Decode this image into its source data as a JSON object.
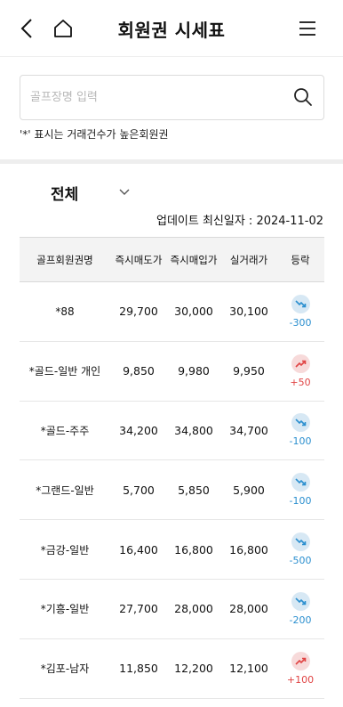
{
  "header": {
    "title": "회원권 시세표"
  },
  "search": {
    "placeholder": "골프장명 입력",
    "value": ""
  },
  "note": "'*' 표시는 거래건수가 높은회원권",
  "filter": {
    "selected": "전체"
  },
  "updated_label": "업데이트 최신일자 : 2024-11-02",
  "table": {
    "columns": [
      "골프회원권명",
      "즉시매도가",
      "즉시매입가",
      "실거래가",
      "등락"
    ],
    "rows": [
      {
        "name": "*88",
        "sell": "29,700",
        "buy": "30,000",
        "real": "30,100",
        "change": "-300",
        "dir": "down"
      },
      {
        "name": "*골드-일반 개인",
        "sell": "9,850",
        "buy": "9,980",
        "real": "9,950",
        "change": "+50",
        "dir": "up"
      },
      {
        "name": "*골드-주주",
        "sell": "34,200",
        "buy": "34,800",
        "real": "34,700",
        "change": "-100",
        "dir": "down"
      },
      {
        "name": "*그랜드-일반",
        "sell": "5,700",
        "buy": "5,850",
        "real": "5,900",
        "change": "-100",
        "dir": "down"
      },
      {
        "name": "*금강-일반",
        "sell": "16,400",
        "buy": "16,800",
        "real": "16,800",
        "change": "-500",
        "dir": "down"
      },
      {
        "name": "*기흥-일반",
        "sell": "27,700",
        "buy": "28,000",
        "real": "28,000",
        "change": "-200",
        "dir": "down"
      },
      {
        "name": "*김포-남자",
        "sell": "11,850",
        "buy": "12,200",
        "real": "12,100",
        "change": "+100",
        "dir": "up"
      }
    ]
  },
  "colors": {
    "down": "#2b8fcf",
    "up": "#e04444",
    "down_bg": "#d7e8f4",
    "up_bg": "#f7dada"
  },
  "icons": {
    "back": "back-chevron-icon",
    "home": "home-icon",
    "menu": "hamburger-menu-icon",
    "search": "search-icon",
    "filter": "chevron-down-icon",
    "down": "trend-down-icon",
    "up": "trend-up-icon"
  }
}
